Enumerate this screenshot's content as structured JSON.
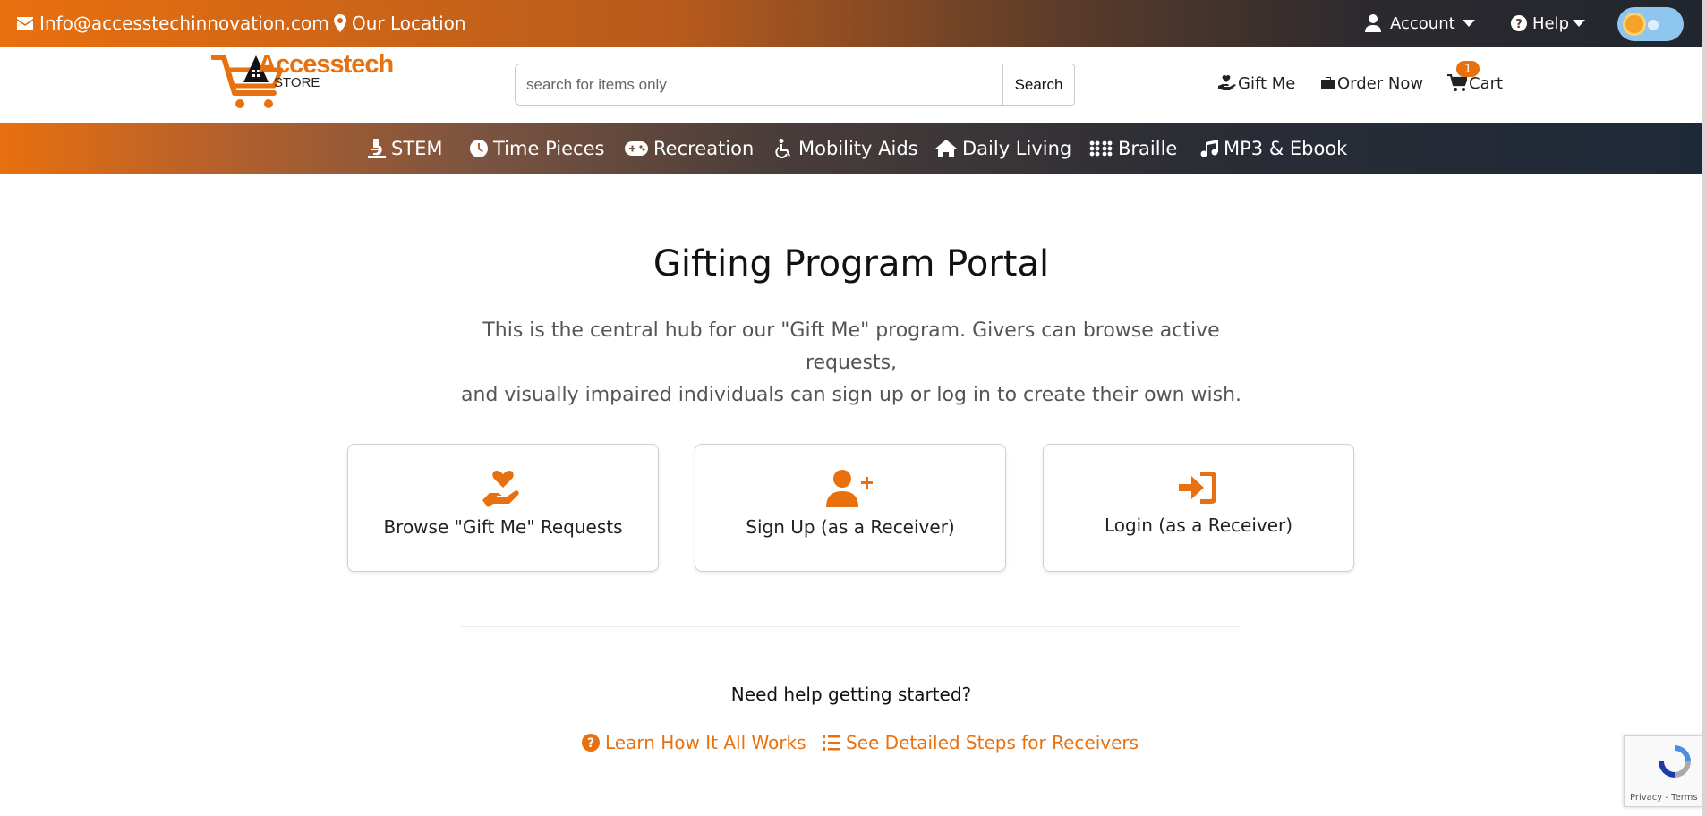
{
  "topbar": {
    "email": "Info@accesstechinnovation.com",
    "location": "Our Location",
    "account_label": "Account",
    "help_label": "Help"
  },
  "header": {
    "logo_main": "Accesstech",
    "logo_sub": "STORE",
    "search_placeholder": "search for items only",
    "search_button": "Search",
    "gift_me": "Gift Me",
    "order_now": "Order Now",
    "cart_label": "Cart",
    "cart_count": "1"
  },
  "nav": {
    "items": [
      {
        "label": "STEM",
        "icon": "microscope-icon"
      },
      {
        "label": "Time Pieces",
        "icon": "clock-icon"
      },
      {
        "label": "Recreation",
        "icon": "gamepad-icon"
      },
      {
        "label": "Mobility Aids",
        "icon": "wheelchair-icon"
      },
      {
        "label": "Daily Living",
        "icon": "home-icon"
      },
      {
        "label": "Braille",
        "icon": "braille-icon"
      },
      {
        "label": "MP3 & Ebook",
        "icon": "music-icon"
      }
    ]
  },
  "main": {
    "title": "Gifting Program Portal",
    "intro_line1": "This is the central hub for our \"Gift Me\" program. Givers can browse active requests,",
    "intro_line2": "and visually impaired individuals can sign up or log in to create their own wish.",
    "cards": [
      {
        "label": "Browse \"Gift Me\" Requests",
        "icon": "hand-holding-heart-icon"
      },
      {
        "label": "Sign Up (as a Receiver)",
        "icon": "user-plus-icon"
      },
      {
        "label": "Login (as a Receiver)",
        "icon": "sign-in-icon"
      }
    ],
    "help_question": "Need help getting started?",
    "help_links": [
      {
        "label": "Learn How It All Works",
        "icon": "question-circle-icon"
      },
      {
        "label": "See Detailed Steps for Receivers",
        "icon": "list-ol-icon"
      }
    ]
  },
  "recaptcha": {
    "terms": "Privacy - Terms"
  },
  "colors": {
    "accent": "#e8700f",
    "dark": "#1e2938"
  }
}
